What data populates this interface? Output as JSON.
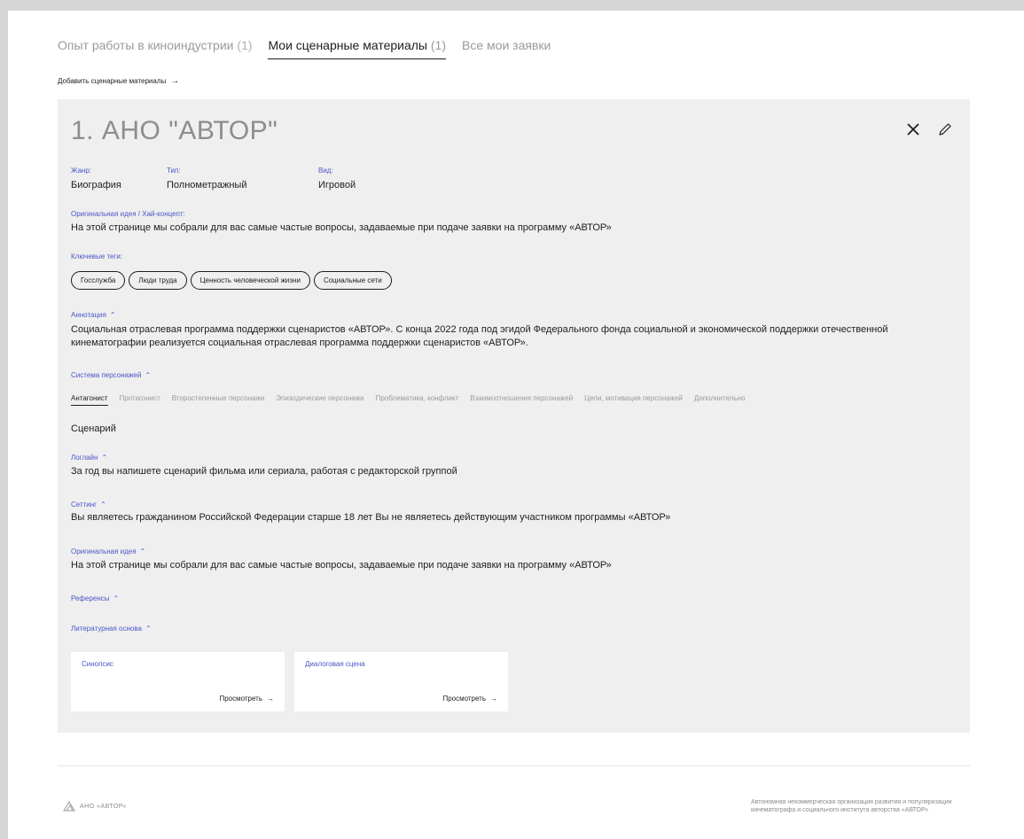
{
  "tabs": [
    {
      "label": "Опыт работы в киноиндустрии",
      "count": "(1)"
    },
    {
      "label": "Мои сценарные материалы",
      "count": "(1)"
    },
    {
      "label": "Все мои заявки",
      "count": ""
    }
  ],
  "add_link": "Добавить сценарные материалы",
  "arrow": "→",
  "card": {
    "title": "1. АНО \"АВТОР\"",
    "genre_label": "Жанр:",
    "genre_value": "Биография",
    "type_label": "Тип:",
    "type_value": "Полнометражный",
    "kind_label": "Вид:",
    "kind_value": "Игровой",
    "idea_label": "Оригинальная идея / Хай-концепт:",
    "idea_value": "На этой странице мы собрали для вас самые частые вопросы, задаваемые при подаче заявки на программу «АВТОР»",
    "tags_label": "Ключевые теги:",
    "tags": [
      "Госслужба",
      "Люди труда",
      "Ценность человеческой жизни",
      "Социальные сети"
    ],
    "annotation_label": "Аннотация",
    "annotation_value": "Социальная отраслевая программа поддержки сценаристов «АВТОР». С конца 2022 года под эгидой Федерального фонда социальной и экономической поддержки отечественной кинематографии реализуется социальная отраслевая программа поддержки сценаристов «АВТОР».",
    "characters_label": "Система персонажей",
    "character_tabs": [
      "Антагонист",
      "Протагонист",
      "Второстепенные персонажи",
      "Эпизодические персонажи",
      "Проблематика, конфликт",
      "Взаимоотношения персонажей",
      "Цели, мотивация персонажей",
      "Дополнительно"
    ],
    "character_content": "Сценарий",
    "logline_label": "Логлайн",
    "logline_value": "За год вы напишете сценарий фильма или сериала, работая с редакторской группой",
    "setting_label": "Сеттинг",
    "setting_value": "Вы являетесь гражданином Российской Федерации старше 18 лет Вы не являетесь действующим участником программы «АВТОР»",
    "orig_label": "Оригинальная идея",
    "orig_value": "На этой странице мы собрали для вас самые частые вопросы, задаваемые при подаче заявки на программу «АВТОР»",
    "refs_label": "Референсы",
    "lit_label": "Литературная основа",
    "docs": [
      {
        "title": "Синопсис",
        "action": "Просмотреть"
      },
      {
        "title": "Диалоговая сцена",
        "action": "Просмотреть"
      }
    ]
  },
  "footer": {
    "logo_text": "АНО «АВТОР»",
    "description": "Автономная некоммерческая организация развития и популяризации кинематографа и социального института авторства «АВТОР»"
  },
  "colors": {
    "accent": "#4a56c8",
    "card_bg": "#efefef",
    "text": "#1e1e1e",
    "muted": "#9a9a9a"
  }
}
